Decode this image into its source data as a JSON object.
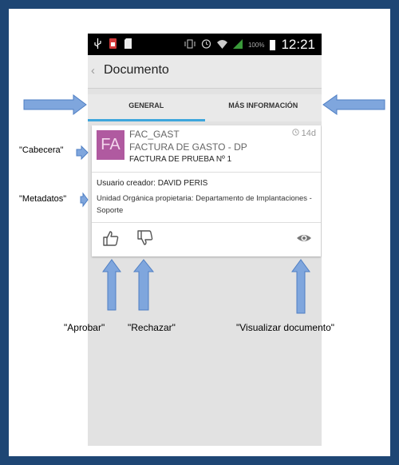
{
  "status_bar": {
    "battery": "100%",
    "time": "12:21"
  },
  "header": {
    "title": "Documento"
  },
  "tabs": [
    {
      "label": "GENERAL"
    },
    {
      "label": "MÁS INFORMACIÓN"
    }
  ],
  "card": {
    "avatar": "FA",
    "code": "FAC_GAST",
    "age": "14d",
    "type": "FACTURA DE GASTO - DP",
    "name": "FACTURA DE PRUEBA Nº 1",
    "creator": "Usuario creador: DAVID PERIS",
    "unit": "Unidad Orgánica propietaria: Departamento de Implantaciones - Soporte"
  },
  "annotations": {
    "cabecera": "\"Cabecera\"",
    "metadatos": "\"Metadatos\"",
    "aprobar": "\"Aprobar\"",
    "rechazar": "\"Rechazar\"",
    "visualizar": "\"Visualizar documento\""
  },
  "colors": {
    "accent": "#3ea6dc",
    "avatar": "#b05aa0",
    "arrow": "#7fa6dd"
  },
  "icons": [
    "usb-icon",
    "sim-icon",
    "sd-card-icon",
    "vibrate-icon",
    "alarm-icon",
    "wifi-icon",
    "signal-icon",
    "battery-icon",
    "back-icon",
    "clock-icon",
    "thumbs-up-icon",
    "thumbs-down-icon",
    "eye-icon"
  ]
}
